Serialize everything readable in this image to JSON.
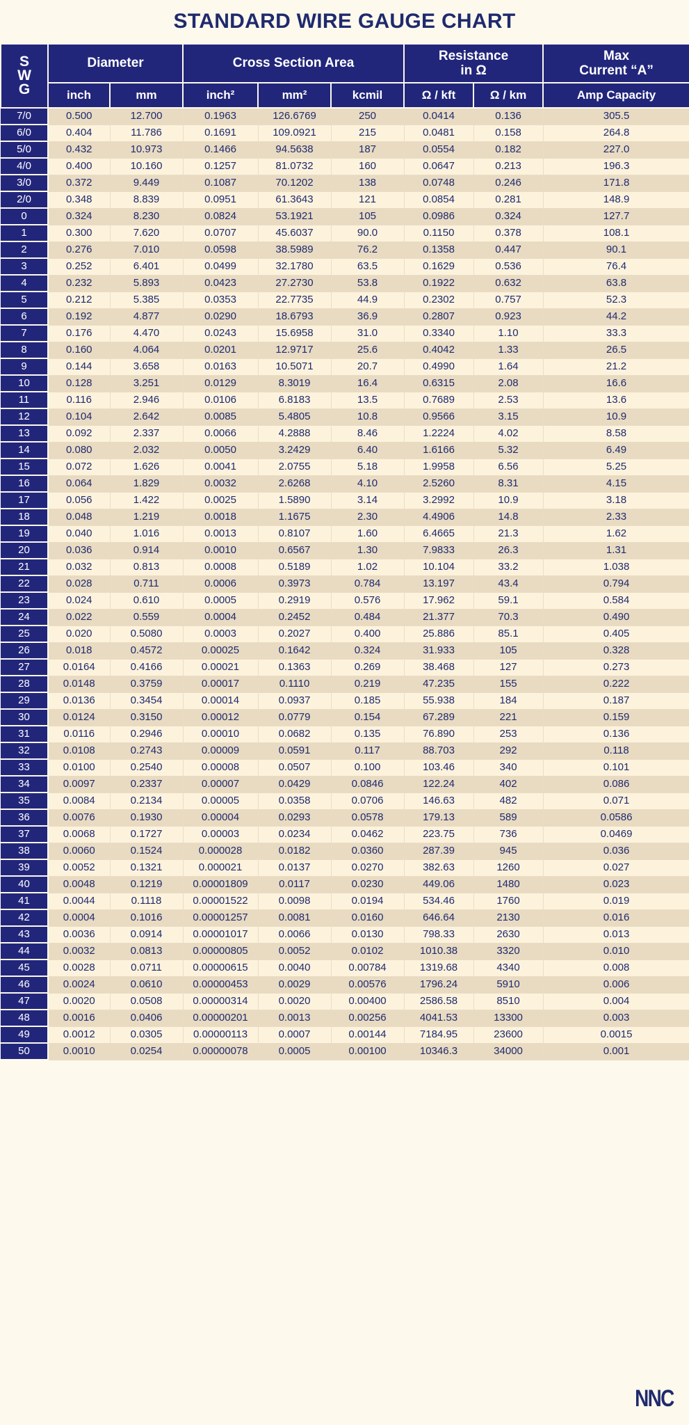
{
  "title": "STANDARD WIRE GAUGE CHART",
  "brand": "NNC",
  "colors": {
    "header_bg": "#22267b",
    "page_bg": "#fdf9ec",
    "row_odd": "#fdf3dd",
    "row_even": "#e8dbc2",
    "text": "#1f2a6e"
  },
  "header": {
    "swg_label": "S\nW\nG",
    "swg_lines": [
      "S",
      "W",
      "G"
    ],
    "groups": [
      {
        "label": "Diameter",
        "span": 2
      },
      {
        "label": "Cross Section Area",
        "span": 3
      },
      {
        "label": "Resistance\nin Ω",
        "span": 2
      },
      {
        "label": "Max\nCurrent “A”",
        "span": 1
      }
    ],
    "group_lines": {
      "diameter": [
        "Diameter"
      ],
      "cross_section": [
        "Cross Section Area"
      ],
      "resistance": [
        "Resistance",
        "in Ω"
      ],
      "max_current": [
        "Max",
        "Current “A”"
      ]
    },
    "subheaders": [
      "inch",
      "mm",
      "inch²",
      "mm²",
      "kcmil",
      "Ω / kft",
      "Ω / km",
      "Amp Capacity"
    ]
  },
  "chart_data": {
    "type": "table",
    "title": "STANDARD WIRE GAUGE CHART",
    "columns": [
      "SWG",
      "inch",
      "mm",
      "inch²",
      "mm²",
      "kcmil",
      "Ω / kft",
      "Ω / km",
      "Amp Capacity"
    ],
    "rows": [
      [
        "7/0",
        "0.500",
        "12.700",
        "0.1963",
        "126.6769",
        "250",
        "0.0414",
        "0.136",
        "305.5"
      ],
      [
        "6/0",
        "0.404",
        "11.786",
        "0.1691",
        "109.0921",
        "215",
        "0.0481",
        "0.158",
        "264.8"
      ],
      [
        "5/0",
        "0.432",
        "10.973",
        "0.1466",
        "94.5638",
        "187",
        "0.0554",
        "0.182",
        "227.0"
      ],
      [
        "4/0",
        "0.400",
        "10.160",
        "0.1257",
        "81.0732",
        "160",
        "0.0647",
        "0.213",
        "196.3"
      ],
      [
        "3/0",
        "0.372",
        "9.449",
        "0.1087",
        "70.1202",
        "138",
        "0.0748",
        "0.246",
        "171.8"
      ],
      [
        "2/0",
        "0.348",
        "8.839",
        "0.0951",
        "61.3643",
        "121",
        "0.0854",
        "0.281",
        "148.9"
      ],
      [
        "0",
        "0.324",
        "8.230",
        "0.0824",
        "53.1921",
        "105",
        "0.0986",
        "0.324",
        "127.7"
      ],
      [
        "1",
        "0.300",
        "7.620",
        "0.0707",
        "45.6037",
        "90.0",
        "0.1150",
        "0.378",
        "108.1"
      ],
      [
        "2",
        "0.276",
        "7.010",
        "0.0598",
        "38.5989",
        "76.2",
        "0.1358",
        "0.447",
        "90.1"
      ],
      [
        "3",
        "0.252",
        "6.401",
        "0.0499",
        "32.1780",
        "63.5",
        "0.1629",
        "0.536",
        "76.4"
      ],
      [
        "4",
        "0.232",
        "5.893",
        "0.0423",
        "27.2730",
        "53.8",
        "0.1922",
        "0.632",
        "63.8"
      ],
      [
        "5",
        "0.212",
        "5.385",
        "0.0353",
        "22.7735",
        "44.9",
        "0.2302",
        "0.757",
        "52.3"
      ],
      [
        "6",
        "0.192",
        "4.877",
        "0.0290",
        "18.6793",
        "36.9",
        "0.2807",
        "0.923",
        "44.2"
      ],
      [
        "7",
        "0.176",
        "4.470",
        "0.0243",
        "15.6958",
        "31.0",
        "0.3340",
        "1.10",
        "33.3"
      ],
      [
        "8",
        "0.160",
        "4.064",
        "0.0201",
        "12.9717",
        "25.6",
        "0.4042",
        "1.33",
        "26.5"
      ],
      [
        "9",
        "0.144",
        "3.658",
        "0.0163",
        "10.5071",
        "20.7",
        "0.4990",
        "1.64",
        "21.2"
      ],
      [
        "10",
        "0.128",
        "3.251",
        "0.0129",
        "8.3019",
        "16.4",
        "0.6315",
        "2.08",
        "16.6"
      ],
      [
        "11",
        "0.116",
        "2.946",
        "0.0106",
        "6.8183",
        "13.5",
        "0.7689",
        "2.53",
        "13.6"
      ],
      [
        "12",
        "0.104",
        "2.642",
        "0.0085",
        "5.4805",
        "10.8",
        "0.9566",
        "3.15",
        "10.9"
      ],
      [
        "13",
        "0.092",
        "2.337",
        "0.0066",
        "4.2888",
        "8.46",
        "1.2224",
        "4.02",
        "8.58"
      ],
      [
        "14",
        "0.080",
        "2.032",
        "0.0050",
        "3.2429",
        "6.40",
        "1.6166",
        "5.32",
        "6.49"
      ],
      [
        "15",
        "0.072",
        "1.626",
        "0.0041",
        "2.0755",
        "5.18",
        "1.9958",
        "6.56",
        "5.25"
      ],
      [
        "16",
        "0.064",
        "1.829",
        "0.0032",
        "2.6268",
        "4.10",
        "2.5260",
        "8.31",
        "4.15"
      ],
      [
        "17",
        "0.056",
        "1.422",
        "0.0025",
        "1.5890",
        "3.14",
        "3.2992",
        "10.9",
        "3.18"
      ],
      [
        "18",
        "0.048",
        "1.219",
        "0.0018",
        "1.1675",
        "2.30",
        "4.4906",
        "14.8",
        "2.33"
      ],
      [
        "19",
        "0.040",
        "1.016",
        "0.0013",
        "0.8107",
        "1.60",
        "6.4665",
        "21.3",
        "1.62"
      ],
      [
        "20",
        "0.036",
        "0.914",
        "0.0010",
        "0.6567",
        "1.30",
        "7.9833",
        "26.3",
        "1.31"
      ],
      [
        "21",
        "0.032",
        "0.813",
        "0.0008",
        "0.5189",
        "1.02",
        "10.104",
        "33.2",
        "1.038"
      ],
      [
        "22",
        "0.028",
        "0.711",
        "0.0006",
        "0.3973",
        "0.784",
        "13.197",
        "43.4",
        "0.794"
      ],
      [
        "23",
        "0.024",
        "0.610",
        "0.0005",
        "0.2919",
        "0.576",
        "17.962",
        "59.1",
        "0.584"
      ],
      [
        "24",
        "0.022",
        "0.559",
        "0.0004",
        "0.2452",
        "0.484",
        "21.377",
        "70.3",
        "0.490"
      ],
      [
        "25",
        "0.020",
        "0.5080",
        "0.0003",
        "0.2027",
        "0.400",
        "25.886",
        "85.1",
        "0.405"
      ],
      [
        "26",
        "0.018",
        "0.4572",
        "0.00025",
        "0.1642",
        "0.324",
        "31.933",
        "105",
        "0.328"
      ],
      [
        "27",
        "0.0164",
        "0.4166",
        "0.00021",
        "0.1363",
        "0.269",
        "38.468",
        "127",
        "0.273"
      ],
      [
        "28",
        "0.0148",
        "0.3759",
        "0.00017",
        "0.1110",
        "0.219",
        "47.235",
        "155",
        "0.222"
      ],
      [
        "29",
        "0.0136",
        "0.3454",
        "0.00014",
        "0.0937",
        "0.185",
        "55.938",
        "184",
        "0.187"
      ],
      [
        "30",
        "0.0124",
        "0.3150",
        "0.00012",
        "0.0779",
        "0.154",
        "67.289",
        "221",
        "0.159"
      ],
      [
        "31",
        "0.0116",
        "0.2946",
        "0.00010",
        "0.0682",
        "0.135",
        "76.890",
        "253",
        "0.136"
      ],
      [
        "32",
        "0.0108",
        "0.2743",
        "0.00009",
        "0.0591",
        "0.117",
        "88.703",
        "292",
        "0.118"
      ],
      [
        "33",
        "0.0100",
        "0.2540",
        "0.00008",
        "0.0507",
        "0.100",
        "103.46",
        "340",
        "0.101"
      ],
      [
        "34",
        "0.0097",
        "0.2337",
        "0.00007",
        "0.0429",
        "0.0846",
        "122.24",
        "402",
        "0.086"
      ],
      [
        "35",
        "0.0084",
        "0.2134",
        "0.00005",
        "0.0358",
        "0.0706",
        "146.63",
        "482",
        "0.071"
      ],
      [
        "36",
        "0.0076",
        "0.1930",
        "0.00004",
        "0.0293",
        "0.0578",
        "179.13",
        "589",
        "0.0586"
      ],
      [
        "37",
        "0.0068",
        "0.1727",
        "0.00003",
        "0.0234",
        "0.0462",
        "223.75",
        "736",
        "0.0469"
      ],
      [
        "38",
        "0.0060",
        "0.1524",
        "0.000028",
        "0.0182",
        "0.0360",
        "287.39",
        "945",
        "0.036"
      ],
      [
        "39",
        "0.0052",
        "0.1321",
        "0.000021",
        "0.0137",
        "0.0270",
        "382.63",
        "1260",
        "0.027"
      ],
      [
        "40",
        "0.0048",
        "0.1219",
        "0.00001809",
        "0.0117",
        "0.0230",
        "449.06",
        "1480",
        "0.023"
      ],
      [
        "41",
        "0.0044",
        "0.1118",
        "0.00001522",
        "0.0098",
        "0.0194",
        "534.46",
        "1760",
        "0.019"
      ],
      [
        "42",
        "0.0004",
        "0.1016",
        "0.00001257",
        "0.0081",
        "0.0160",
        "646.64",
        "2130",
        "0.016"
      ],
      [
        "43",
        "0.0036",
        "0.0914",
        "0.00001017",
        "0.0066",
        "0.0130",
        "798.33",
        "2630",
        "0.013"
      ],
      [
        "44",
        "0.0032",
        "0.0813",
        "0.00000805",
        "0.0052",
        "0.0102",
        "1010.38",
        "3320",
        "0.010"
      ],
      [
        "45",
        "0.0028",
        "0.0711",
        "0.00000615",
        "0.0040",
        "0.00784",
        "1319.68",
        "4340",
        "0.008"
      ],
      [
        "46",
        "0.0024",
        "0.0610",
        "0.00000453",
        "0.0029",
        "0.00576",
        "1796.24",
        "5910",
        "0.006"
      ],
      [
        "47",
        "0.0020",
        "0.0508",
        "0.00000314",
        "0.0020",
        "0.00400",
        "2586.58",
        "8510",
        "0.004"
      ],
      [
        "48",
        "0.0016",
        "0.0406",
        "0.00000201",
        "0.0013",
        "0.00256",
        "4041.53",
        "13300",
        "0.003"
      ],
      [
        "49",
        "0.0012",
        "0.0305",
        "0.00000113",
        "0.0007",
        "0.00144",
        "7184.95",
        "23600",
        "0.0015"
      ],
      [
        "50",
        "0.0010",
        "0.0254",
        "0.00000078",
        "0.0005",
        "0.00100",
        "10346.3",
        "34000",
        "0.001"
      ]
    ]
  }
}
